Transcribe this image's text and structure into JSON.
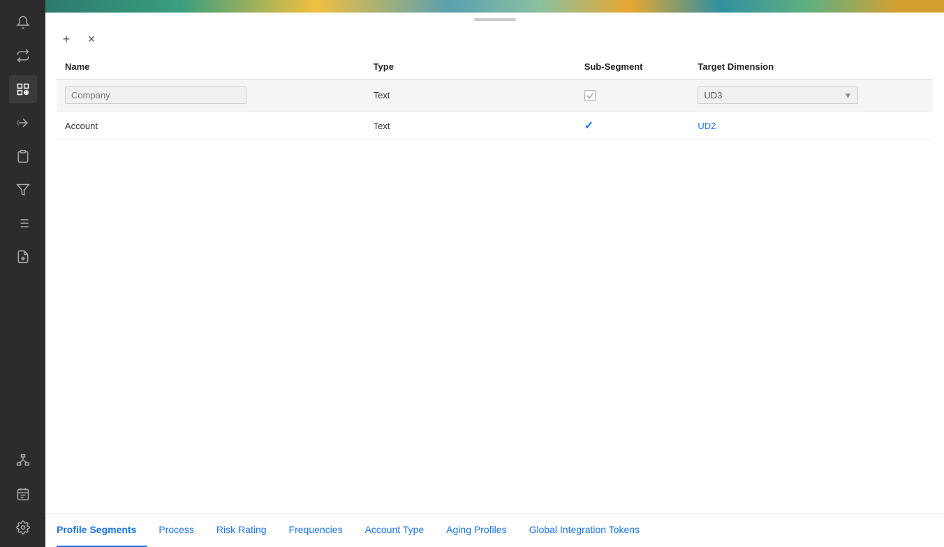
{
  "sidebar": {
    "icons": [
      {
        "name": "bell-icon",
        "symbol": "🔔",
        "active": false
      },
      {
        "name": "refresh-icon",
        "symbol": "⟳",
        "active": false
      },
      {
        "name": "profile-settings-icon",
        "symbol": "⚙",
        "active": true
      },
      {
        "name": "arrow-right-icon",
        "symbol": "→",
        "active": false
      },
      {
        "name": "document-icon",
        "symbol": "📄",
        "active": false
      },
      {
        "name": "filter-icon",
        "symbol": "⚗",
        "active": false
      },
      {
        "name": "list-icon",
        "symbol": "≡",
        "active": false
      },
      {
        "name": "report-icon",
        "symbol": "📊",
        "active": false
      },
      {
        "name": "network-icon",
        "symbol": "⊞",
        "active": false
      },
      {
        "name": "calendar-icon",
        "symbol": "📅",
        "active": false
      },
      {
        "name": "settings-icon",
        "symbol": "⚙",
        "active": false
      }
    ]
  },
  "toolbar": {
    "add_label": "+",
    "remove_label": "×"
  },
  "table": {
    "columns": [
      "Name",
      "Type",
      "Sub-Segment",
      "Target Dimension"
    ],
    "rows": [
      {
        "name": "Company",
        "name_placeholder": "Company",
        "type": "Text",
        "subsegment": "gray_checkbox",
        "target": "UD3",
        "selected": true
      },
      {
        "name": "Account",
        "name_placeholder": "",
        "type": "Text",
        "subsegment": "checked",
        "target": "UD2",
        "selected": false
      }
    ]
  },
  "bottom_tabs": [
    {
      "label": "Profile Segments",
      "active": true
    },
    {
      "label": "Process",
      "active": false
    },
    {
      "label": "Risk Rating",
      "active": false
    },
    {
      "label": "Frequencies",
      "active": false
    },
    {
      "label": "Account Type",
      "active": false
    },
    {
      "label": "Aging Profiles",
      "active": false
    },
    {
      "label": "Global Integration Tokens",
      "active": false
    }
  ]
}
